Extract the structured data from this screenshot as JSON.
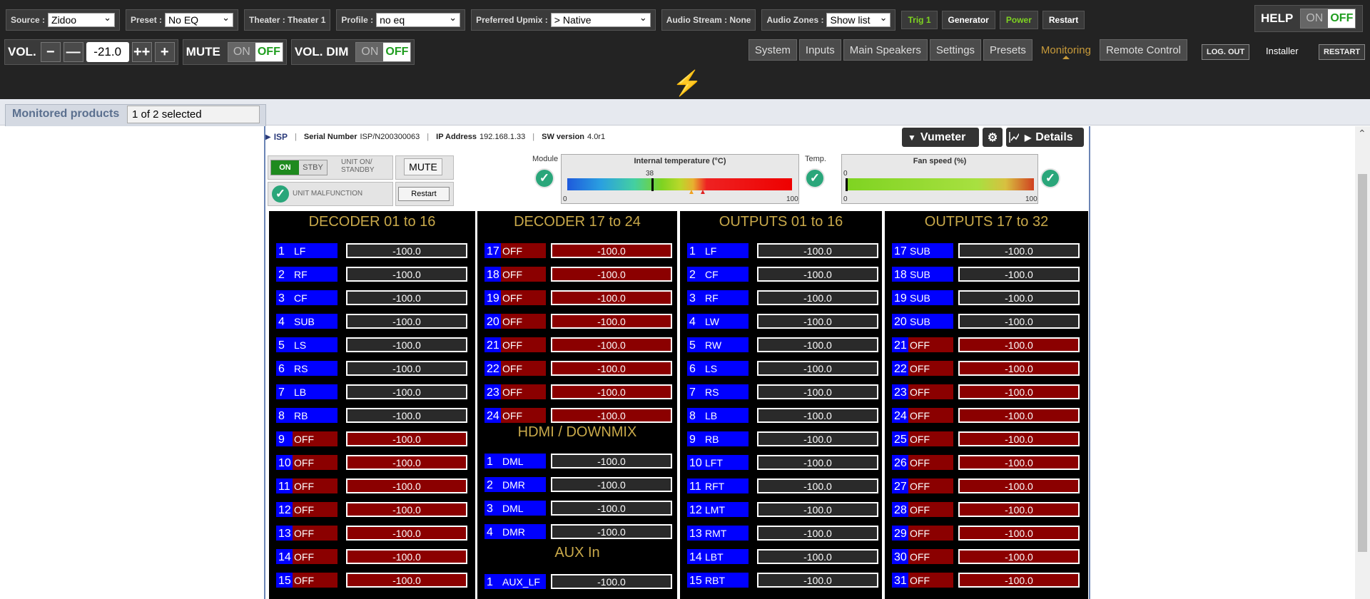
{
  "topbar": {
    "source_label": "Source :",
    "source_value": "Zidoo",
    "preset_label": "Preset :",
    "preset_value": "No EQ",
    "theater_label": "Theater : Theater 1",
    "profile_label": "Profile :",
    "profile_value": "no eq",
    "upmix_label": "Preferred Upmix :",
    "upmix_value": "> Native",
    "audio_stream_label": "Audio Stream : None",
    "zones_label": "Audio Zones :",
    "zones_value": "Show list",
    "trig1": "Trig 1",
    "generator": "Generator",
    "power": "Power",
    "restart": "Restart",
    "help": "HELP",
    "help_on": "ON",
    "help_off": "OFF"
  },
  "volume": {
    "vol_label": "VOL.",
    "value": "-21.0",
    "mute_label": "MUTE",
    "mute_on": "ON",
    "mute_off": "OFF",
    "dim_label": "VOL. DIM",
    "dim_on": "ON",
    "dim_off": "OFF"
  },
  "nav": {
    "items": [
      "System",
      "Inputs",
      "Main Speakers",
      "Settings",
      "Presets",
      "Monitoring",
      "Remote Control"
    ],
    "active": "Monitoring",
    "logout": "LOG. OUT",
    "user": "Installer",
    "restart": "RESTART"
  },
  "monitored": {
    "title": "Monitored products",
    "selection": "1 of 2 selected"
  },
  "product": {
    "name": "ISP",
    "serial_label": "Serial Number",
    "serial": "ISP/N200300063",
    "ip_label": "IP Address",
    "ip": "192.168.1.33",
    "sw_label": "SW version",
    "sw": "4.0r1",
    "vumeter_btn": "Vumeter",
    "details_btn": "Details",
    "on_label": "ON",
    "stby_label": "STBY",
    "unit_on_standby": "UNIT ON/ STANDBY",
    "mute_btn": "MUTE",
    "malfunction": "UNIT MALFUNCTION",
    "restart_btn": "Restart",
    "module_label": "Module",
    "temp_title": "Internal temperature (°C)",
    "temp_value": "38",
    "temp_min": "0",
    "temp_max": "100",
    "temp_label": "Temp.",
    "fan_title": "Fan speed (%)",
    "fan_value": "0",
    "fan_min": "0",
    "fan_max": "100"
  },
  "columns": [
    {
      "title": "DECODER 01 to 16",
      "channels": [
        {
          "n": "1",
          "label": "LF",
          "off": false,
          "value": "-100.0"
        },
        {
          "n": "2",
          "label": "RF",
          "off": false,
          "value": "-100.0"
        },
        {
          "n": "3",
          "label": "CF",
          "off": false,
          "value": "-100.0"
        },
        {
          "n": "4",
          "label": "SUB",
          "off": false,
          "value": "-100.0"
        },
        {
          "n": "5",
          "label": "LS",
          "off": false,
          "value": "-100.0"
        },
        {
          "n": "6",
          "label": "RS",
          "off": false,
          "value": "-100.0"
        },
        {
          "n": "7",
          "label": "LB",
          "off": false,
          "value": "-100.0"
        },
        {
          "n": "8",
          "label": "RB",
          "off": false,
          "value": "-100.0"
        },
        {
          "n": "9",
          "label": "OFF",
          "off": true,
          "value": "-100.0"
        },
        {
          "n": "10",
          "label": "OFF",
          "off": true,
          "value": "-100.0"
        },
        {
          "n": "11",
          "label": "OFF",
          "off": true,
          "value": "-100.0"
        },
        {
          "n": "12",
          "label": "OFF",
          "off": true,
          "value": "-100.0"
        },
        {
          "n": "13",
          "label": "OFF",
          "off": true,
          "value": "-100.0"
        },
        {
          "n": "14",
          "label": "OFF",
          "off": true,
          "value": "-100.0"
        },
        {
          "n": "15",
          "label": "OFF",
          "off": true,
          "value": "-100.0"
        }
      ]
    },
    {
      "title": "DECODER 17 to 24",
      "channels": [
        {
          "n": "17",
          "label": "OFF",
          "off": true,
          "value": "-100.0"
        },
        {
          "n": "18",
          "label": "OFF",
          "off": true,
          "value": "-100.0"
        },
        {
          "n": "19",
          "label": "OFF",
          "off": true,
          "value": "-100.0"
        },
        {
          "n": "20",
          "label": "OFF",
          "off": true,
          "value": "-100.0"
        },
        {
          "n": "21",
          "label": "OFF",
          "off": true,
          "value": "-100.0"
        },
        {
          "n": "22",
          "label": "OFF",
          "off": true,
          "value": "-100.0"
        },
        {
          "n": "23",
          "label": "OFF",
          "off": true,
          "value": "-100.0"
        },
        {
          "n": "24",
          "label": "OFF",
          "off": true,
          "value": "-100.0"
        }
      ],
      "sub1_title": "HDMI / DOWNMIX",
      "sub1": [
        {
          "n": "1",
          "label": "DML",
          "off": false,
          "value": "-100.0"
        },
        {
          "n": "2",
          "label": "DMR",
          "off": false,
          "value": "-100.0"
        },
        {
          "n": "3",
          "label": "DML",
          "off": false,
          "value": "-100.0"
        },
        {
          "n": "4",
          "label": "DMR",
          "off": false,
          "value": "-100.0"
        }
      ],
      "sub2_title": "AUX In",
      "sub2": [
        {
          "n": "1",
          "label": "AUX_LF",
          "off": false,
          "value": "-100.0"
        }
      ]
    },
    {
      "title": "OUTPUTS 01 to 16",
      "channels": [
        {
          "n": "1",
          "label": "LF",
          "off": false,
          "value": "-100.0"
        },
        {
          "n": "2",
          "label": "CF",
          "off": false,
          "value": "-100.0"
        },
        {
          "n": "3",
          "label": "RF",
          "off": false,
          "value": "-100.0"
        },
        {
          "n": "4",
          "label": "LW",
          "off": false,
          "value": "-100.0"
        },
        {
          "n": "5",
          "label": "RW",
          "off": false,
          "value": "-100.0"
        },
        {
          "n": "6",
          "label": "LS",
          "off": false,
          "value": "-100.0"
        },
        {
          "n": "7",
          "label": "RS",
          "off": false,
          "value": "-100.0"
        },
        {
          "n": "8",
          "label": "LB",
          "off": false,
          "value": "-100.0"
        },
        {
          "n": "9",
          "label": "RB",
          "off": false,
          "value": "-100.0"
        },
        {
          "n": "10",
          "label": "LFT",
          "off": false,
          "value": "-100.0"
        },
        {
          "n": "11",
          "label": "RFT",
          "off": false,
          "value": "-100.0"
        },
        {
          "n": "12",
          "label": "LMT",
          "off": false,
          "value": "-100.0"
        },
        {
          "n": "13",
          "label": "RMT",
          "off": false,
          "value": "-100.0"
        },
        {
          "n": "14",
          "label": "LBT",
          "off": false,
          "value": "-100.0"
        },
        {
          "n": "15",
          "label": "RBT",
          "off": false,
          "value": "-100.0"
        }
      ]
    },
    {
      "title": "OUTPUTS 17 to 32",
      "channels": [
        {
          "n": "17",
          "label": "SUB",
          "off": false,
          "value": "-100.0"
        },
        {
          "n": "18",
          "label": "SUB",
          "off": false,
          "value": "-100.0"
        },
        {
          "n": "19",
          "label": "SUB",
          "off": false,
          "value": "-100.0"
        },
        {
          "n": "20",
          "label": "SUB",
          "off": false,
          "value": "-100.0"
        },
        {
          "n": "21",
          "label": "OFF",
          "off": true,
          "value": "-100.0"
        },
        {
          "n": "22",
          "label": "OFF",
          "off": true,
          "value": "-100.0"
        },
        {
          "n": "23",
          "label": "OFF",
          "off": true,
          "value": "-100.0"
        },
        {
          "n": "24",
          "label": "OFF",
          "off": true,
          "value": "-100.0"
        },
        {
          "n": "25",
          "label": "OFF",
          "off": true,
          "value": "-100.0"
        },
        {
          "n": "26",
          "label": "OFF",
          "off": true,
          "value": "-100.0"
        },
        {
          "n": "27",
          "label": "OFF",
          "off": true,
          "value": "-100.0"
        },
        {
          "n": "28",
          "label": "OFF",
          "off": true,
          "value": "-100.0"
        },
        {
          "n": "29",
          "label": "OFF",
          "off": true,
          "value": "-100.0"
        },
        {
          "n": "30",
          "label": "OFF",
          "off": true,
          "value": "-100.0"
        },
        {
          "n": "31",
          "label": "OFF",
          "off": true,
          "value": "-100.0"
        }
      ]
    }
  ],
  "colors": {
    "accent": "#c79a3a",
    "channel_on": "#0000ff",
    "channel_off": "#8b0000",
    "ok": "#2aa67a",
    "green": "#7ed321"
  },
  "icons": [
    "lightning-icon",
    "gear-icon",
    "chart-icon",
    "play-icon",
    "chevron-down-icon",
    "check-icon"
  ]
}
